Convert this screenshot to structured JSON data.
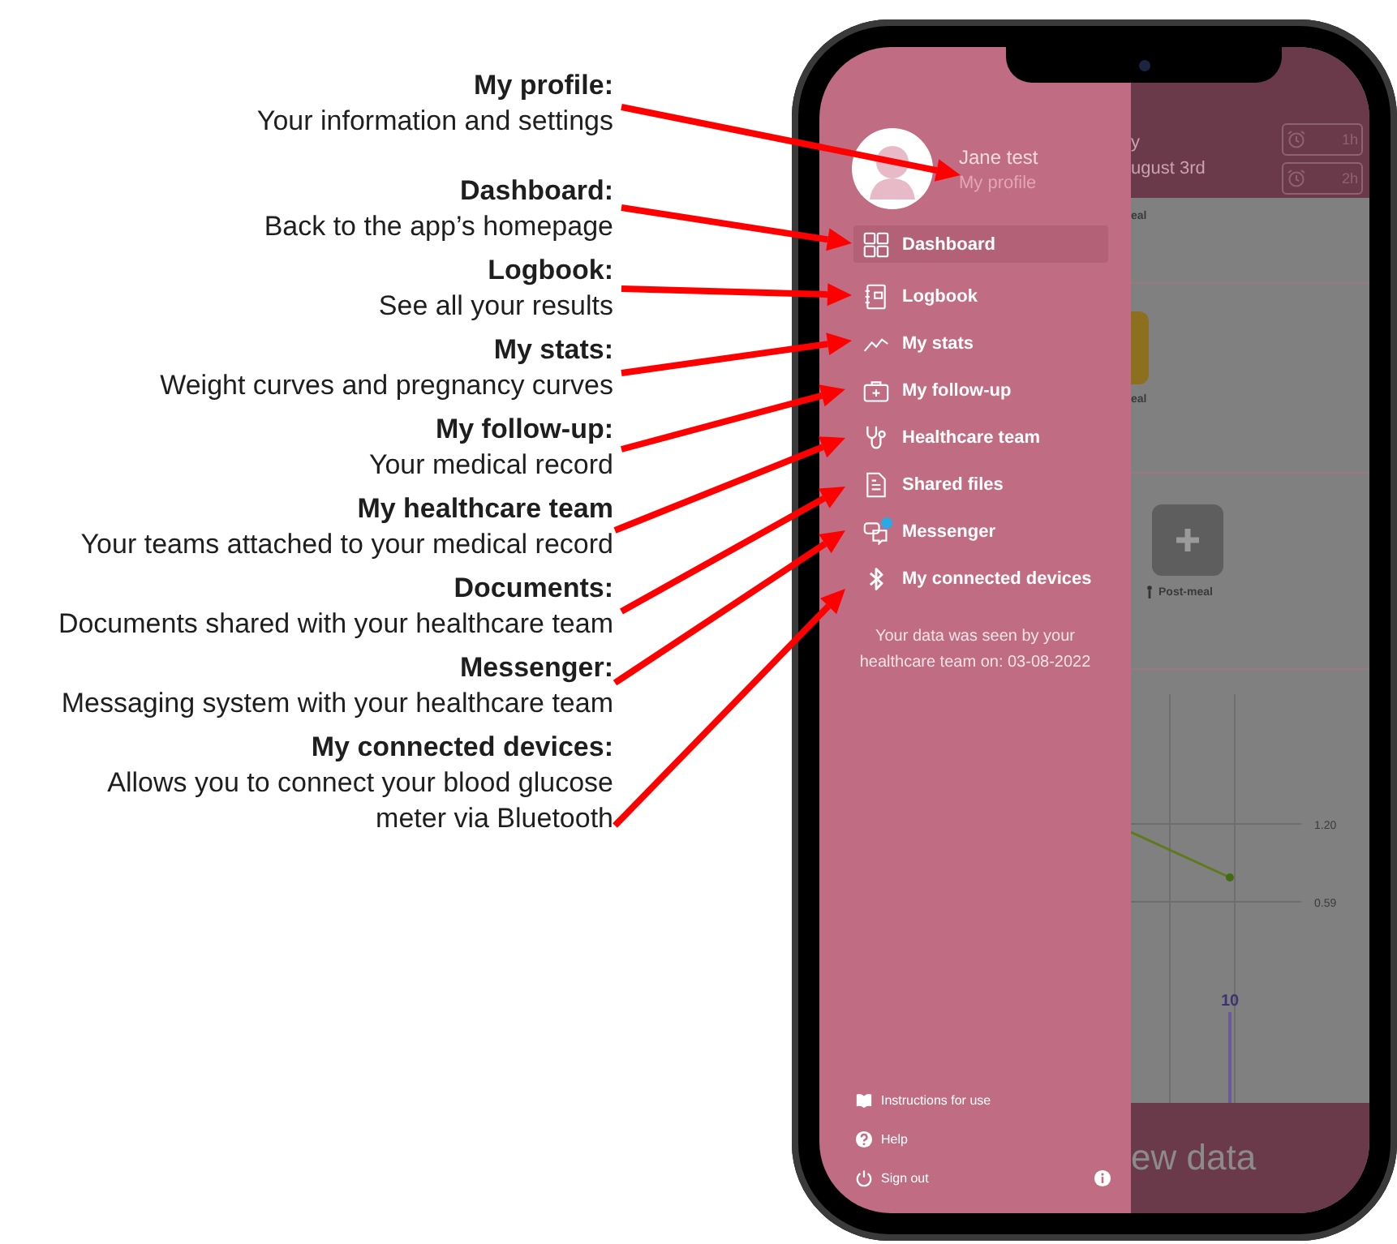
{
  "annotations": [
    {
      "title": "My profile:",
      "lines": [
        "Your information and settings"
      ]
    },
    {
      "title": "Dashboard:",
      "lines": [
        "Back to the app’s homepage"
      ]
    },
    {
      "title": "Logbook:",
      "lines": [
        "See all your results"
      ]
    },
    {
      "title": "My stats:",
      "lines": [
        "Weight curves and pregnancy curves"
      ]
    },
    {
      "title": "My follow-up:",
      "lines": [
        "Your medical record"
      ]
    },
    {
      "title": "My healthcare team",
      "lines": [
        "Your teams attached to your medical record"
      ]
    },
    {
      "title": "Documents:",
      "lines": [
        "Documents shared with your healthcare team"
      ]
    },
    {
      "title": "Messenger:",
      "lines": [
        "Messaging system with your healthcare team"
      ]
    },
    {
      "title": "My connected devices:",
      "lines": [
        "Allows you to connect your blood glucose",
        "meter via Bluetooth"
      ]
    }
  ],
  "profile": {
    "name": "Jane test",
    "link": "My profile"
  },
  "menu": [
    {
      "kind": "grid",
      "label": "Dashboard",
      "selected": true,
      "unread": false
    },
    {
      "kind": "notebook",
      "label": "Logbook",
      "selected": false,
      "unread": false
    },
    {
      "kind": "stats",
      "label": "My stats",
      "selected": false,
      "unread": false
    },
    {
      "kind": "kit",
      "label": "My follow-up",
      "selected": false,
      "unread": false
    },
    {
      "kind": "stethoscope",
      "label": "Healthcare team",
      "selected": false,
      "unread": false
    },
    {
      "kind": "document",
      "label": "Shared files",
      "selected": false,
      "unread": false
    },
    {
      "kind": "chat",
      "label": "Messenger",
      "selected": false,
      "unread": true
    },
    {
      "kind": "bluetooth",
      "label": "My connected devices",
      "selected": false,
      "unread": false
    }
  ],
  "notice": "Your data was seen by your healthcare team on: 03-08-2022",
  "footer": [
    {
      "kind": "book",
      "label": "Instructions for use"
    },
    {
      "kind": "help",
      "label": "Help"
    },
    {
      "kind": "power",
      "label": "Sign out"
    }
  ],
  "background": {
    "header_lines": [
      "y",
      "ugust 3rd"
    ],
    "reminders": [
      "1h",
      "2h"
    ],
    "card_labels": [
      "eal",
      "eal"
    ],
    "add_label": "Post-meal",
    "ticks": [
      "1.20",
      "0.59"
    ],
    "bar_value": "10",
    "button": "ew data"
  }
}
